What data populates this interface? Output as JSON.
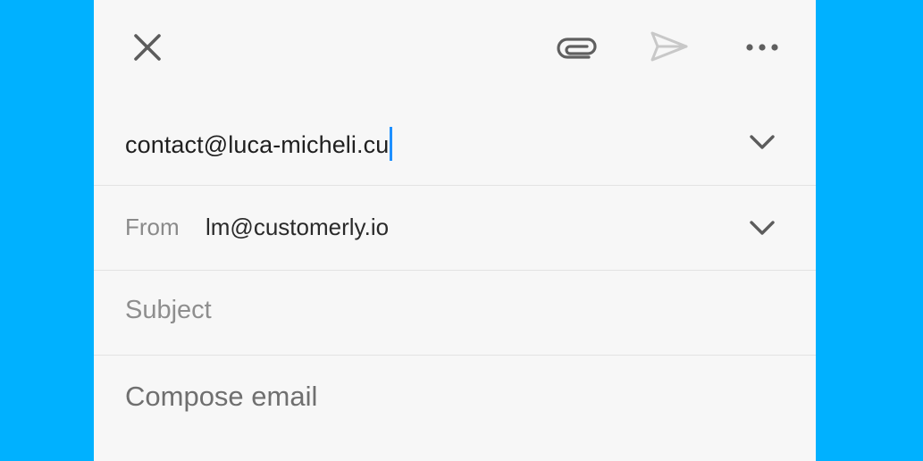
{
  "toolbar": {
    "close_icon": "close-icon",
    "attach_icon": "paperclip-icon",
    "send_icon": "send-icon",
    "more_icon": "more-horizontal-icon"
  },
  "to": {
    "value": "contact@luca-micheli.cu",
    "expand_icon": "chevron-down-icon"
  },
  "from": {
    "label": "From",
    "value": "lm@customerly.io",
    "expand_icon": "chevron-down-icon"
  },
  "subject": {
    "placeholder": "Subject"
  },
  "compose": {
    "placeholder": "Compose email"
  },
  "colors": {
    "background": "#00b1ff",
    "panel": "#f7f7f7",
    "caret": "#1e90ff",
    "icon": "#5f5f5f",
    "send_disabled": "#c8c8c8"
  }
}
